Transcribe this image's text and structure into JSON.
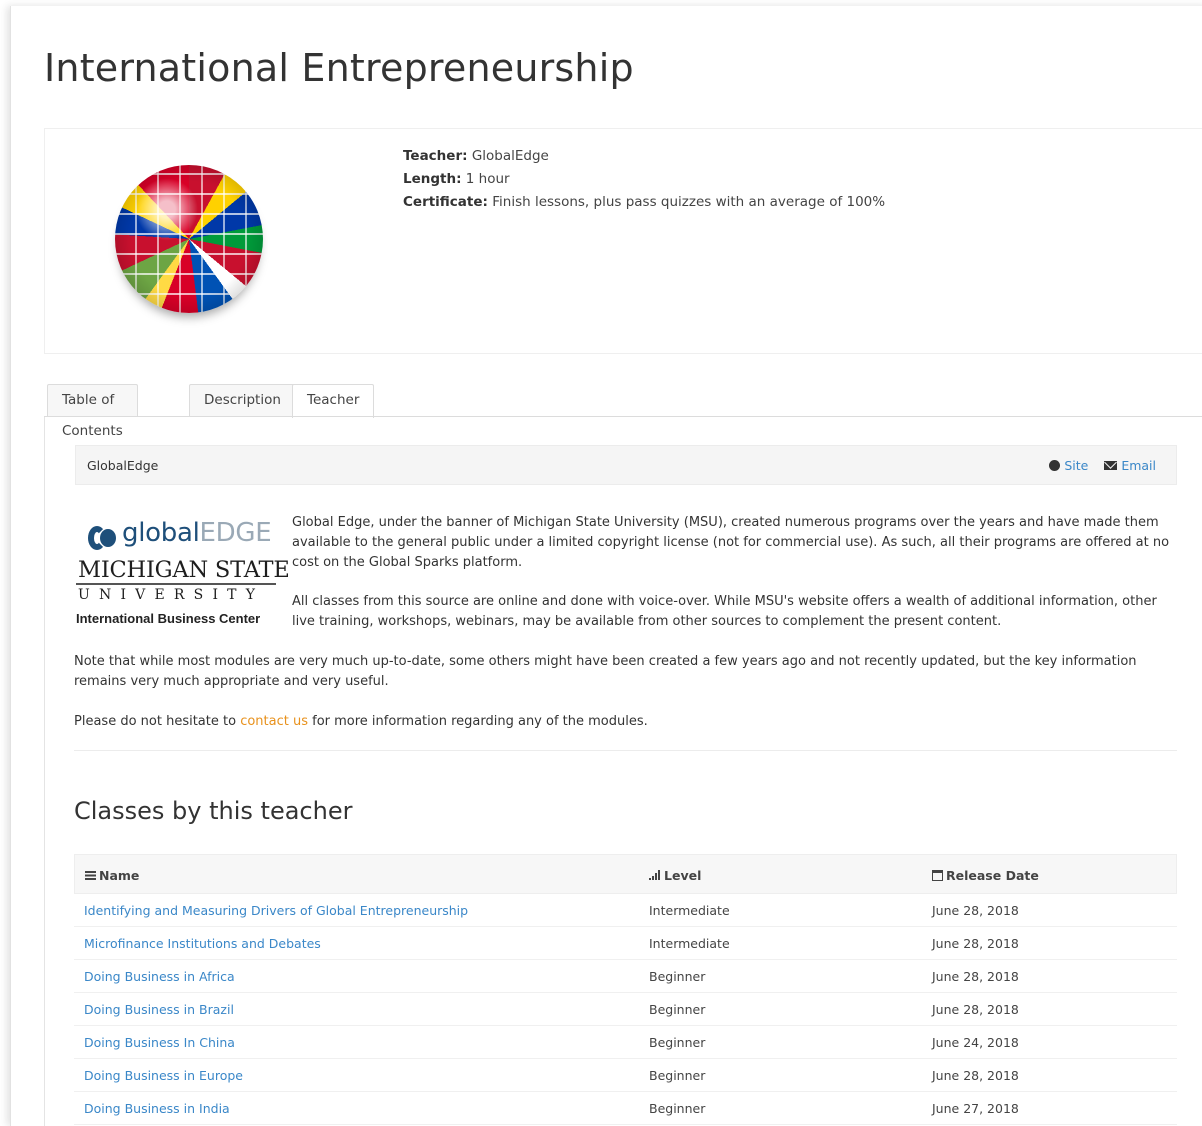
{
  "page": {
    "title": "International Entrepreneurship"
  },
  "course": {
    "teacher_label": "Teacher:",
    "teacher_value": "GlobalEdge",
    "length_label": "Length:",
    "length_value": "1 hour",
    "certificate_label": "Certificate:",
    "certificate_value": "Finish lessons, plus pass quizzes with an average of 100%"
  },
  "tabs": [
    {
      "label": "Table of Contents"
    },
    {
      "label": "Description"
    },
    {
      "label": "Teacher"
    }
  ],
  "teacher": {
    "name": "GlobalEdge",
    "site_label": "Site",
    "email_label": "Email",
    "logo": {
      "word_global": "global",
      "word_edge": "EDGE",
      "msu": "MICHIGAN STATE",
      "university": "UNIVERSITY",
      "ibc": "International Business Center"
    },
    "p1": "Global Edge, under the banner of Michigan State University (MSU), created numerous programs over the years and have made them available to the general public under a limited copyright license (not for commercial use). As such, all their programs are offered at no cost on the Global Sparks platform.",
    "p2": "All classes from this source are online and done with voice-over. While MSU's website offers a wealth of additional information, other live training, workshops, webinars, may be available from other sources to complement the present content.",
    "p3": "Note that while most modules are very much up-to-date, some others might have been created a few years ago and not recently updated, but the key information remains very much appropriate and very useful.",
    "p4_before": "Please do not hesitate to ",
    "p4_link": "contact us",
    "p4_after": " for more information regarding any of the modules."
  },
  "classes": {
    "title": "Classes by this teacher",
    "headers": {
      "name": "Name",
      "level": "Level",
      "date": "Release Date"
    },
    "rows": [
      {
        "name": "Identifying and Measuring Drivers of Global Entrepreneurship",
        "level": "Intermediate",
        "date": "June 28, 2018"
      },
      {
        "name": "Microfinance Institutions and Debates",
        "level": "Intermediate",
        "date": "June 28, 2018"
      },
      {
        "name": "Doing Business in Africa",
        "level": "Beginner",
        "date": "June 28, 2018"
      },
      {
        "name": "Doing Business in Brazil",
        "level": "Beginner",
        "date": "June 28, 2018"
      },
      {
        "name": "Doing Business In China",
        "level": "Beginner",
        "date": "June 24, 2018"
      },
      {
        "name": "Doing Business in Europe",
        "level": "Beginner",
        "date": "June 28, 2018"
      },
      {
        "name": "Doing Business in India",
        "level": "Beginner",
        "date": "June 27, 2018"
      }
    ]
  },
  "colors": {
    "link": "#3a87c8",
    "accent_link": "#e8911c",
    "logo_blue": "#1e4f7a"
  },
  "icons": [
    "globe-flags-image",
    "site-globe-icon",
    "email-icon",
    "list-icon",
    "signal-bars-icon",
    "calendar-icon"
  ]
}
